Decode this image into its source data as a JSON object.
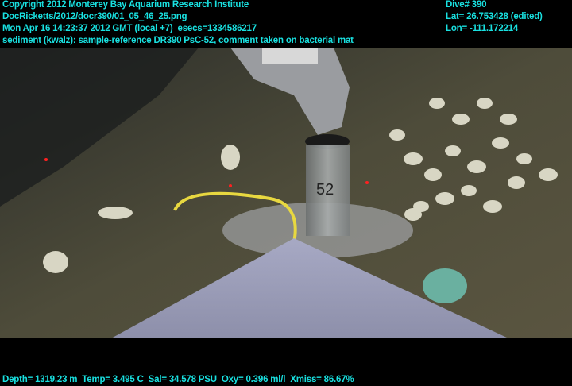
{
  "header_left": {
    "copyright": "Copyright 2012 Monterey Bay Aquarium Research Institute",
    "filename": "DocRicketts/2012/docr390/01_05_46_25.png",
    "timestamp": "Mon Apr 16 14:23:37 2012 GMT (local +7)  esecs=1334586217",
    "comment": "sediment (kwalz): sample-reference DR390 PsC-52, comment taken on bacterial mat"
  },
  "header_right": {
    "dive": "Dive# 390",
    "lat": "Lat= 26.753428 (edited)",
    "lon": "Lon= -111.172214"
  },
  "footer": {
    "sensors": "Depth= 1319.23 m  Temp= 3.495 C  Sal= 34.578 PSU  Oxy= 0.396 ml/l  Xmiss= 86.67%"
  },
  "scene": {
    "tube_label": "52",
    "colors": {
      "overlay_text": "#19e0e0",
      "sediment": "#4a4a38",
      "platform": "#9a9cb8",
      "rope": "#e8d840"
    }
  }
}
